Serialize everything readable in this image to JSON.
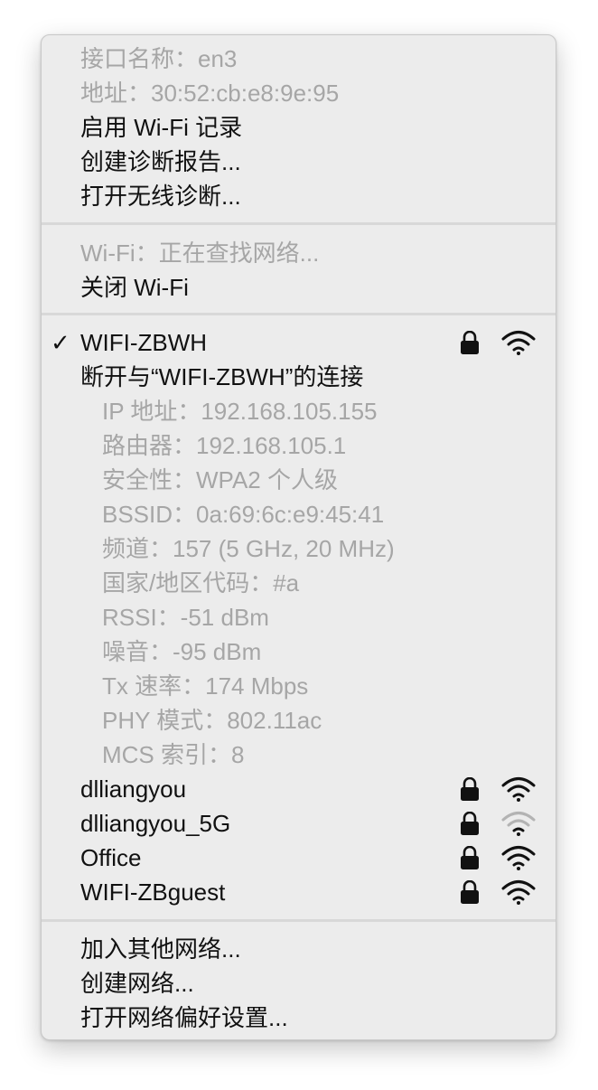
{
  "menu": {
    "info": {
      "interface_name": "接口名称：en3",
      "address": "地址：30:52:cb:e8:9e:95"
    },
    "diag": {
      "enable_logging": "启用 Wi-Fi 记录",
      "create_report": "创建诊断报告...",
      "open_diagnostics": "打开无线诊断..."
    },
    "wifi": {
      "status": "Wi-Fi：正在查找网络...",
      "turn_off": "关闭 Wi-Fi"
    },
    "current": {
      "check": "✓",
      "name": "WIFI-ZBWH",
      "disconnect": "断开与“WIFI-ZBWH”的连接",
      "details": [
        "IP 地址：192.168.105.155",
        "路由器：192.168.105.1",
        "安全性：WPA2 个人级",
        "BSSID：0a:69:6c:e9:45:41",
        "频道：157 (5 GHz, 20 MHz)",
        "国家/地区代码：#a",
        "RSSI：-51 dBm",
        "噪音：-95 dBm",
        "Tx 速率：174 Mbps",
        "PHY 模式：802.11ac",
        "MCS 索引：8"
      ]
    },
    "networks": [
      {
        "name": "dlliangyou",
        "signal_bars": 3
      },
      {
        "name": "dlliangyou_5G",
        "signal_bars": 1
      },
      {
        "name": "Office",
        "signal_bars": 3
      },
      {
        "name": "WIFI-ZBguest",
        "signal_bars": 3
      }
    ],
    "bottom": {
      "join_other": "加入其他网络...",
      "create_network": "创建网络...",
      "open_prefs": "打开网络偏好设置..."
    },
    "icons": {
      "lock": "lock-icon",
      "wifi": "wifi-signal-icon"
    },
    "colors": {
      "menu_bg": "#ececec",
      "text": "#111111",
      "disabled_text": "#a6a6a6",
      "separator": "#d8d8d8",
      "wifi_weak": "#b3b3b3"
    }
  }
}
